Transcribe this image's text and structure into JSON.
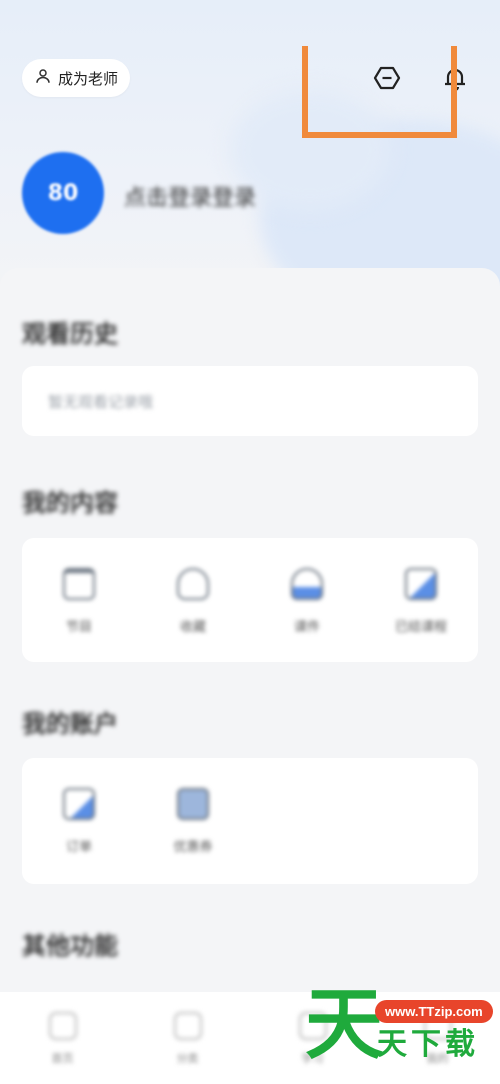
{
  "header": {
    "become_teacher_label": "成为老师",
    "icons": [
      "user-icon",
      "hexagon-minus-icon",
      "bell-icon"
    ]
  },
  "profile": {
    "avatar_initials": "80",
    "nickname": "点击登录登录"
  },
  "sections": {
    "browse_history": {
      "title": "观看历史",
      "placeholder": "暂无观看记录哦"
    },
    "my_content": {
      "title": "我的内容",
      "items": [
        {
          "label": "节目",
          "icon": "calendar-icon"
        },
        {
          "label": "收藏",
          "icon": "star-icon"
        },
        {
          "label": "课件",
          "icon": "cloud-icon"
        },
        {
          "label": "已结课程",
          "icon": "document-icon"
        }
      ]
    },
    "my_account": {
      "title": "我的账户",
      "items": [
        {
          "label": "订单",
          "icon": "order-icon"
        },
        {
          "label": "优惠券",
          "icon": "coupon-icon"
        }
      ]
    },
    "other_functions": {
      "title": "其他功能"
    }
  },
  "tabbar": {
    "items": [
      {
        "label": "首页",
        "icon": "home-icon"
      },
      {
        "label": "分类",
        "icon": "category-icon"
      },
      {
        "label": "学习",
        "icon": "study-icon"
      },
      {
        "label": "我的",
        "icon": "profile-icon"
      }
    ]
  },
  "watermark": {
    "big_char": "天",
    "url": "www.TTzip.com",
    "text": "天下载"
  },
  "colors": {
    "accent_blue": "#1e6ff0",
    "highlight_orange": "#f08a3c",
    "watermark_green": "#1faa3c",
    "watermark_red": "#e8452b"
  }
}
